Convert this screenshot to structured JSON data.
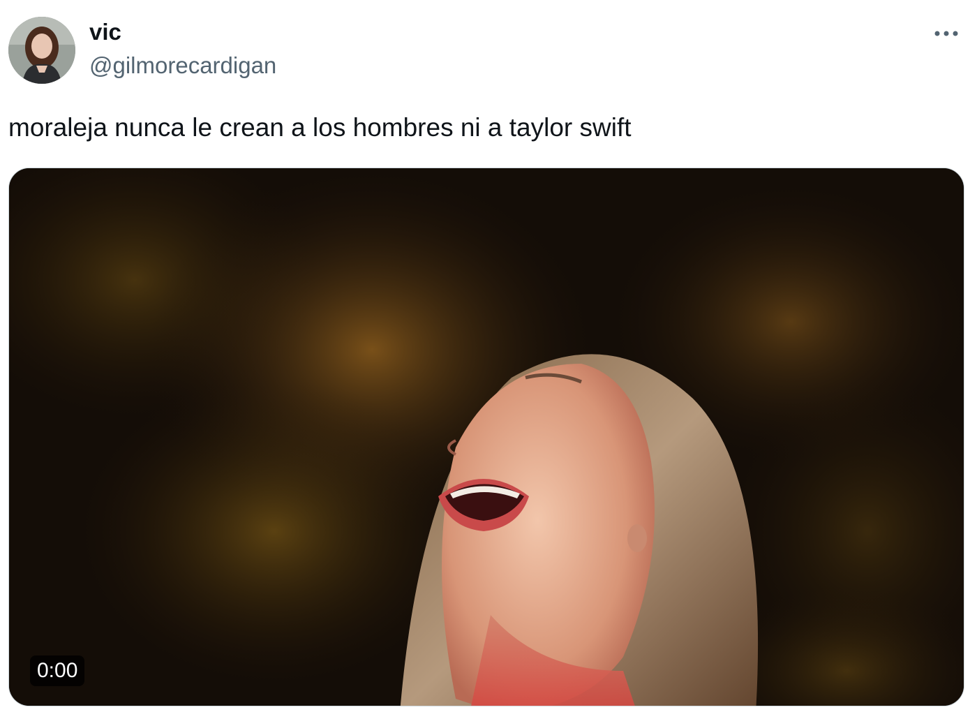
{
  "tweet": {
    "display_name": "vic",
    "handle": "@gilmorecardigan",
    "text": "moraleja nunca le crean a los hombres ni a taylor swift",
    "more_icon": "more-horizontal-icon"
  },
  "media": {
    "type": "video",
    "timestamp": "0:00"
  },
  "colors": {
    "text_primary": "#0f1419",
    "text_secondary": "#536471",
    "border": "#cfd9de"
  }
}
